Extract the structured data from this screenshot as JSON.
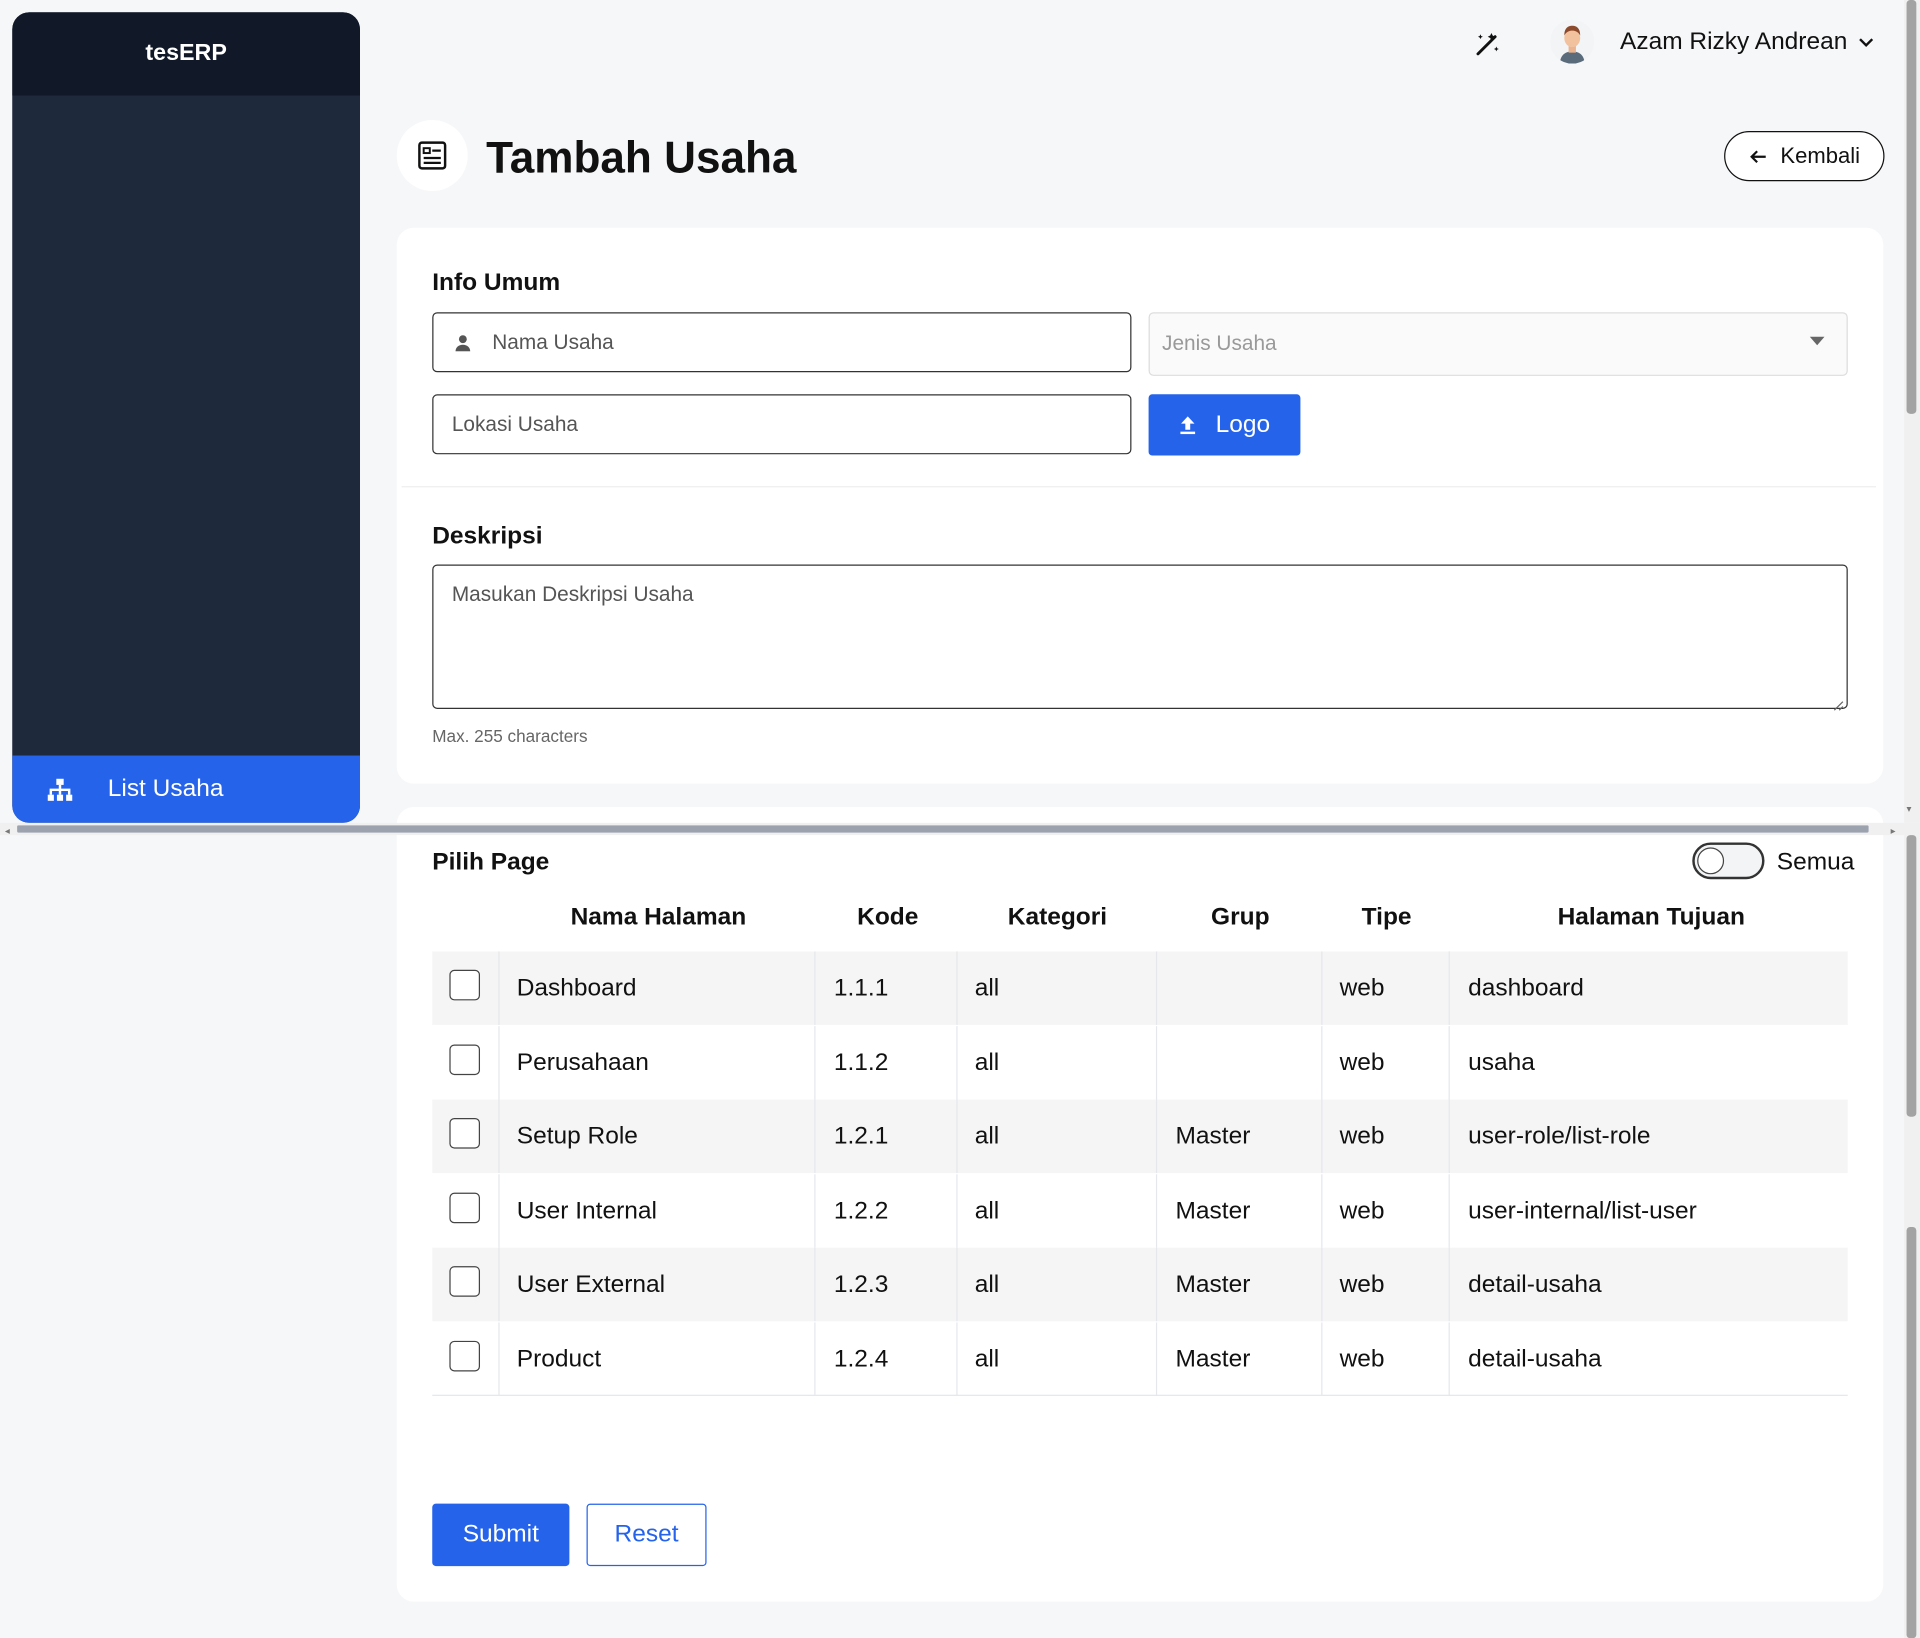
{
  "app": {
    "brand": "tesERP"
  },
  "sidebar": {
    "items": [
      {
        "label": "List Usaha",
        "icon": "sitemap-icon",
        "active": true
      }
    ]
  },
  "topbar": {
    "user_name": "Azam Rizky Andrean",
    "theme_icon": "magic-wand-icon"
  },
  "page": {
    "title": "Tambah Usaha",
    "back_label": "Kembali"
  },
  "form": {
    "info_title": "Info Umum",
    "nama_placeholder": "Nama Usaha",
    "jenis_placeholder": "Jenis Usaha",
    "lokasi_placeholder": "Lokasi Usaha",
    "logo_label": "Logo",
    "deskripsi_title": "Deskripsi",
    "deskripsi_placeholder": "Masukan Deskripsi Usaha",
    "deskripsi_hint": "Max. 255 characters"
  },
  "pages": {
    "title": "Pilih Page",
    "toggle_label": "Semua",
    "toggle_on": false,
    "columns": [
      "Nama Halaman",
      "Kode",
      "Kategori",
      "Grup",
      "Tipe",
      "Halaman Tujuan"
    ],
    "rows": [
      {
        "nama": "Dashboard",
        "kode": "1.1.1",
        "kategori": "all",
        "grup": "",
        "tipe": "web",
        "tujuan": "dashboard"
      },
      {
        "nama": "Perusahaan",
        "kode": "1.1.2",
        "kategori": "all",
        "grup": "",
        "tipe": "web",
        "tujuan": "usaha"
      },
      {
        "nama": "Setup Role",
        "kode": "1.2.1",
        "kategori": "all",
        "grup": "Master",
        "tipe": "web",
        "tujuan": "user-role/list-role"
      },
      {
        "nama": "User Internal",
        "kode": "1.2.2",
        "kategori": "all",
        "grup": "Master",
        "tipe": "web",
        "tujuan": "user-internal/list-user"
      },
      {
        "nama": "User External",
        "kode": "1.2.3",
        "kategori": "all",
        "grup": "Master",
        "tipe": "web",
        "tujuan": "detail-usaha"
      },
      {
        "nama": "Product",
        "kode": "1.2.4",
        "kategori": "all",
        "grup": "Master",
        "tipe": "web",
        "tujuan": "detail-usaha"
      }
    ]
  },
  "actions": {
    "submit_label": "Submit",
    "reset_label": "Reset"
  },
  "colors": {
    "primary": "#2563eb",
    "sidebar_bg": "#1e293b",
    "sidebar_head": "#111827"
  }
}
